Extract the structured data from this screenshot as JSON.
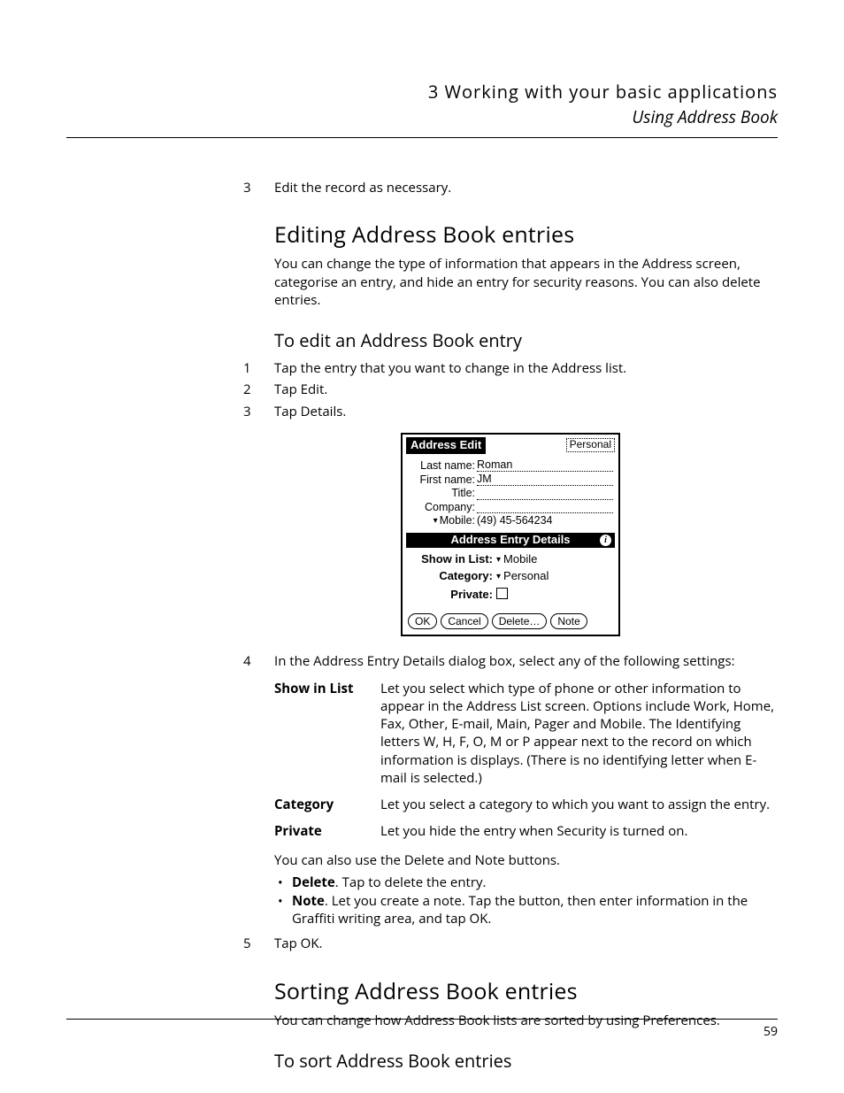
{
  "header": {
    "chapter": "3 Working with your basic applications",
    "section": "Using Address Book"
  },
  "step3_cont": {
    "num": "3",
    "text": "Edit the record as necessary."
  },
  "h_edit": "Editing Address Book entries",
  "p_edit": "You can change the type of information that appears in the Address screen, categorise an entry, and hide an entry for security reasons. You can also delete entries.",
  "h_toedit": "To edit an Address Book entry",
  "steps_edit": [
    {
      "num": "1",
      "text": "Tap the entry that you want to change in the Address list."
    },
    {
      "num": "2",
      "text": "Tap Edit."
    },
    {
      "num": "3",
      "text": "Tap Details."
    }
  ],
  "device": {
    "title": "Address Edit",
    "category": "Personal",
    "fields": {
      "last_name_label": "Last name:",
      "last_name": "Roman",
      "first_name_label": "First name:",
      "first_name": "JM",
      "title_label": "Title:",
      "title": "",
      "company_label": "Company:",
      "company": "",
      "mobile_label": "Mobile:",
      "mobile": "(49) 45-564234"
    },
    "details_bar": "Address Entry Details",
    "opts": {
      "show_label": "Show in List:",
      "show_val": "Mobile",
      "cat_label": "Category:",
      "cat_val": "Personal",
      "priv_label": "Private:"
    },
    "buttons": {
      "ok": "OK",
      "cancel": "Cancel",
      "delete": "Delete…",
      "note": "Note"
    }
  },
  "step4": {
    "num": "4",
    "text": "In the Address Entry Details dialog box, select any of the following settings:"
  },
  "defs": {
    "show_term": "Show in List",
    "show_body": "Let you select which type of phone or other information to appear in the Address List screen. Options include Work, Home, Fax, Other, E-mail, Main, Pager and Mobile. The Identifying letters W, H, F, O, M or P appear next to the record on which information is displays. (There is no identifying letter when E-mail is selected.)",
    "cat_term": "Category",
    "cat_body": "Let you select a category to which you want to assign the entry.",
    "priv_term": "Private",
    "priv_body": "Let you hide the entry when Security is turned on."
  },
  "p_delnote": "You can also use the Delete and Note buttons.",
  "bullets": {
    "del_term": "Delete",
    "del_rest": ". Tap to delete the entry.",
    "note_term": "Note",
    "note_rest": ". Let you create a note. Tap the button, then enter information in the Graffiti writing area, and tap OK."
  },
  "step5": {
    "num": "5",
    "text": "Tap OK."
  },
  "h_sort": "Sorting Address Book entries",
  "p_sort": "You can change how Address Book lists are sorted by using Preferences.",
  "h_tosort": "To sort Address Book entries",
  "page_number": "59"
}
